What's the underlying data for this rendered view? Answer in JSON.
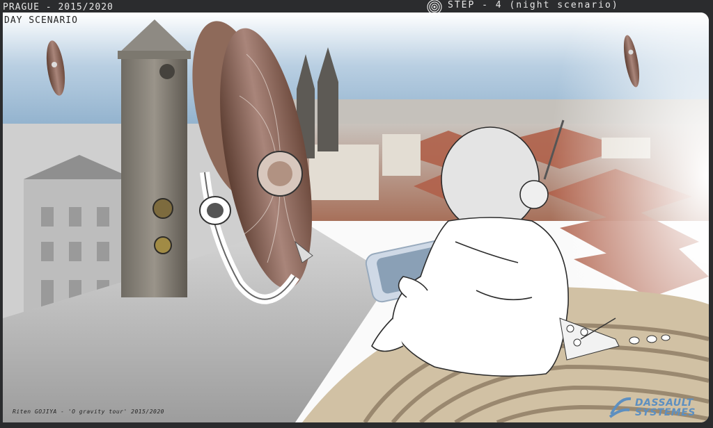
{
  "header": {
    "left_title": "PRAGUE - 2015/2020",
    "step_text": "STEP - 4  (night scenario)"
  },
  "scene": {
    "label": "DAY SCENARIO",
    "credit": "Riten GOJIYA - 'O gravity tour'  2015/2020"
  },
  "logo": {
    "line1": "DASSAULT",
    "line2": "SYSTEMES"
  },
  "colors": {
    "background": "#2b2c2e",
    "sky": "#9fbdd6",
    "roofs": "#b56a4e",
    "airship": "#8a6553",
    "platform": "#c9b595",
    "logo_blue": "#5d8fc0"
  },
  "icons": {
    "step_marker": "target-circle-icon",
    "logo_mark": "ds-logo-icon"
  }
}
